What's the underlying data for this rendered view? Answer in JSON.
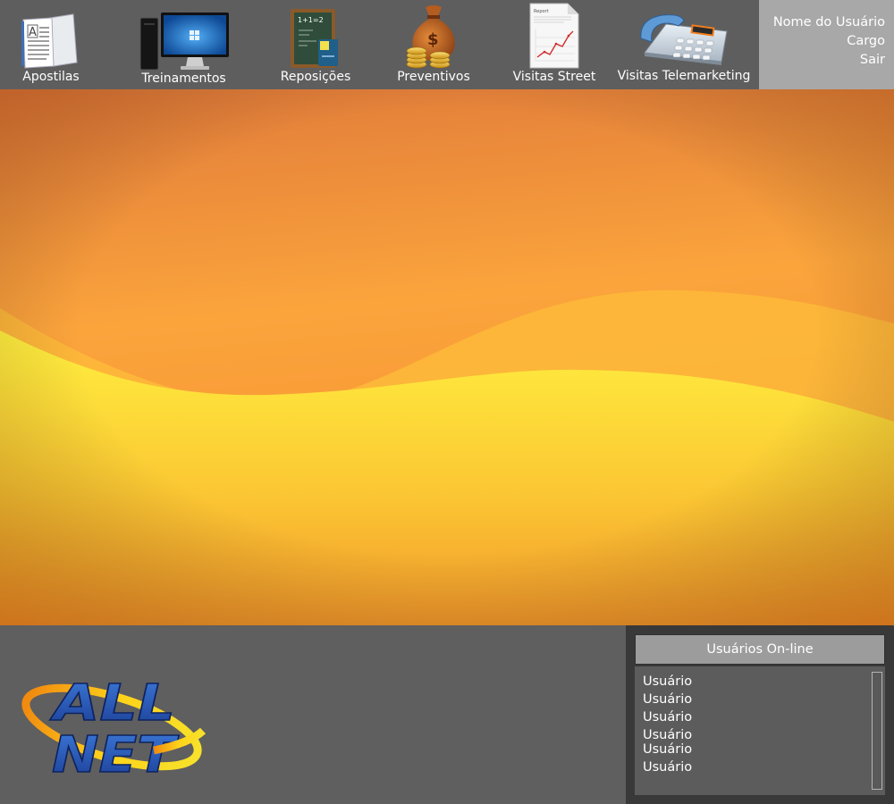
{
  "nav": {
    "items": [
      {
        "label": "Apostilas",
        "icon": "document-icon"
      },
      {
        "label": "Treinamentos",
        "icon": "computer-monitor-icon"
      },
      {
        "label": "Reposições",
        "icon": "chalkboard-icon"
      },
      {
        "label": "Preventivos",
        "icon": "money-bag-coins-icon"
      },
      {
        "label": "Visitas Street",
        "icon": "report-chart-icon"
      },
      {
        "label": "Visitas Telemarketing",
        "icon": "telephone-icon"
      }
    ]
  },
  "user": {
    "name": "Nome do Usuário",
    "role": "Cargo",
    "logout": "Sair"
  },
  "online": {
    "title": "Usuários On-line",
    "users": [
      "Usuário",
      "Usuário",
      "Usuário",
      "Usuário",
      "Usuário",
      "Usuário"
    ]
  },
  "logo": {
    "line1": "ALL",
    "line2": "NET"
  },
  "colors": {
    "bar": "#5e5e5e",
    "user_panel": "#a8a8a8",
    "hero_orange": "#f7a13a",
    "hero_yellow": "#fde93a"
  }
}
